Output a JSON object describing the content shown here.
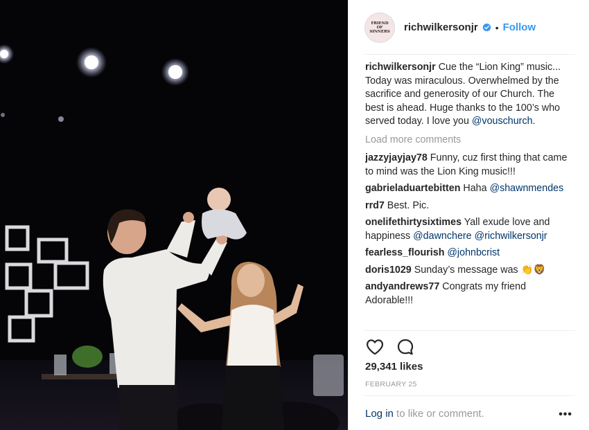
{
  "post": {
    "image_alt": ""
  },
  "header": {
    "avatar_text": "FRIEND\nOF\nSINNERS",
    "username": "richwilkersonjr",
    "separator": "•",
    "follow_label": "Follow"
  },
  "caption": {
    "username": "richwilkersonjr",
    "text": " Cue the “Lion King” music... Today was miraculous. Overwhelmed by the sacrifice and generosity of our Church. The best is ahead. Huge thanks to the 100’s who served today. I love you ",
    "mention": "@vouschurch",
    "end": "."
  },
  "load_more_label": "Load more comments",
  "comments": [
    {
      "username": "jazzyjayjay78",
      "text": " Funny, cuz first thing that came to mind was the Lion King music!!!",
      "mentions": []
    },
    {
      "username": "gabrieladuartebitten",
      "text": " Haha ",
      "mentions": [
        "@shawnmendes"
      ]
    },
    {
      "username": "rrd7",
      "text": " Best. Pic.",
      "mentions": []
    },
    {
      "username": "onelifethirtysixtimes",
      "text": " Yall exude love and happiness ",
      "mentions": [
        "@dawnchere",
        " ",
        "@richwilkersonjr"
      ]
    },
    {
      "username": "fearless_flourish",
      "text": " ",
      "mentions": [
        "@johnbcrist"
      ]
    },
    {
      "username": "doris1029",
      "text": " Sunday’s message was 👏🦁",
      "mentions": []
    },
    {
      "username": "andyandrews77",
      "text": " Congrats my friend Adorable!!!",
      "mentions": []
    }
  ],
  "actions": {
    "like_icon": "heart-outline-icon",
    "comment_icon": "comment-bubble-icon"
  },
  "likes_text": "29,341 likes",
  "date_text": "FEBRUARY 25",
  "footer": {
    "login_label": "Log in",
    "rest": " to like or comment.",
    "more_label": "•••"
  },
  "colors": {
    "link_blue": "#3897f0",
    "mention_navy": "#003569",
    "muted_gray": "#999999",
    "photo_bg": "#050508"
  }
}
